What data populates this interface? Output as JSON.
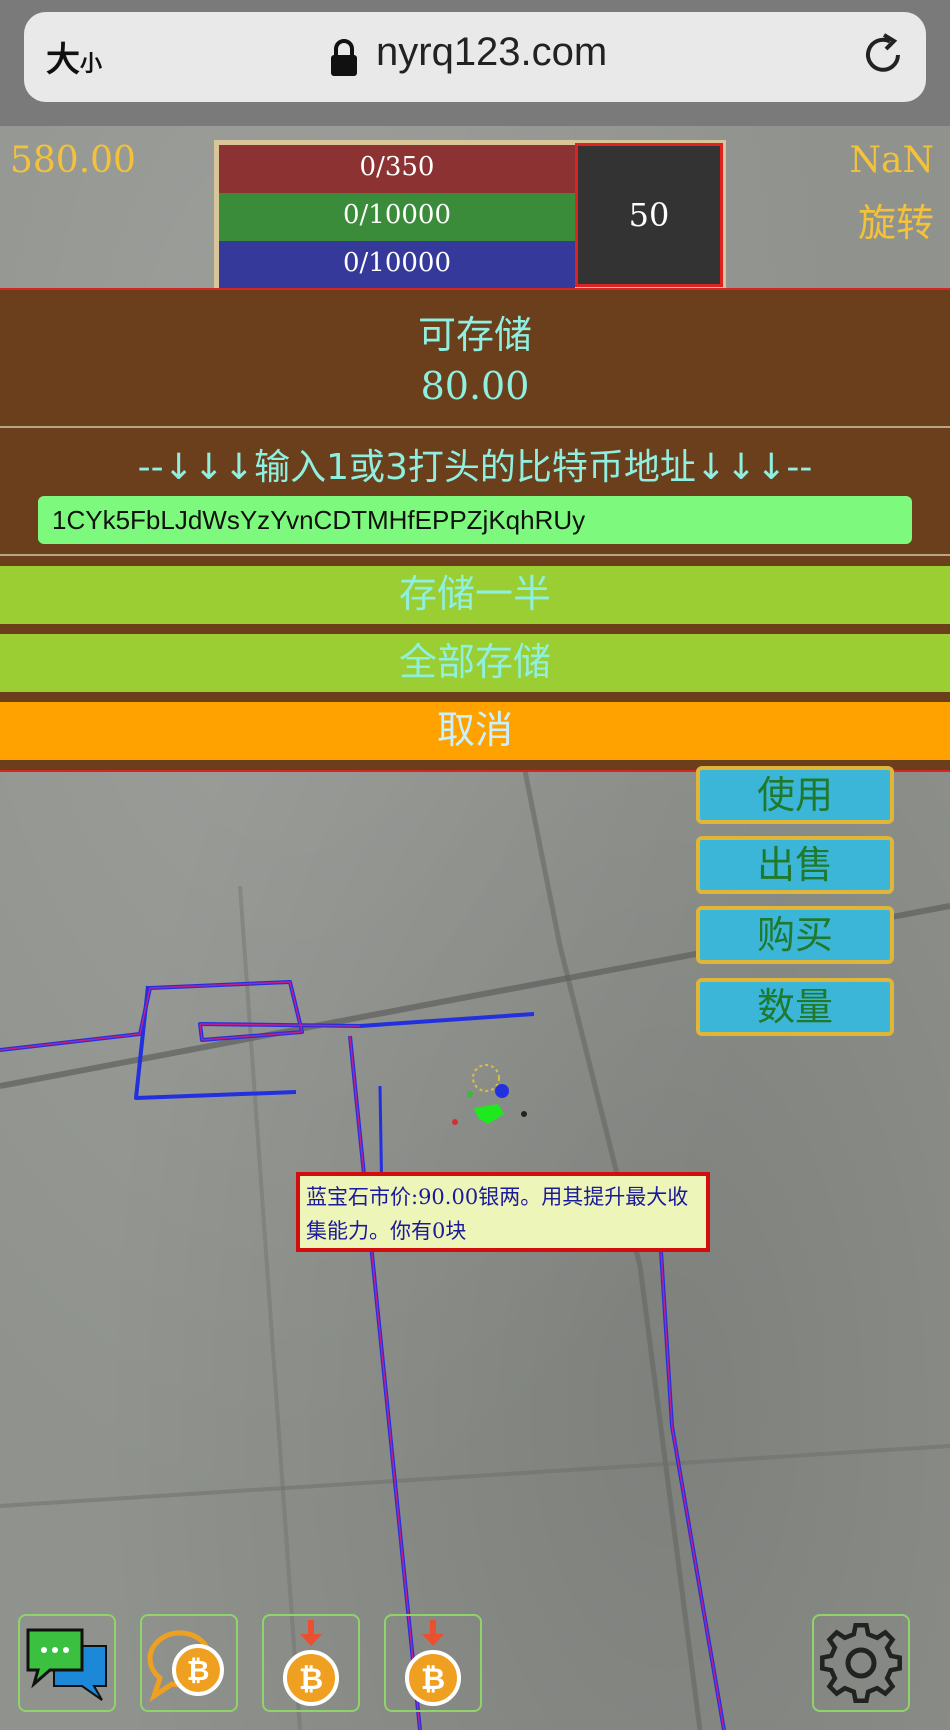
{
  "browser": {
    "text_size_large": "大",
    "text_size_small": "小",
    "url": "nyrq123.com"
  },
  "hud": {
    "silver": "580.00",
    "nan": "NaN",
    "rotate": "旋转",
    "stats": {
      "red": "0/350",
      "green": "0/10000",
      "blue": "0/10000",
      "box": "50"
    }
  },
  "dialog": {
    "title": "可存储",
    "amount": "80.00",
    "prompt": "--↓↓↓输入1或3打头的比特币地址↓↓↓--",
    "address_value": "1CYk5FbLJdWsYzYvnCDTMHfEPPZjKqhRUy",
    "btn_half": "存储一半",
    "btn_all": "全部存储",
    "btn_cancel": "取消"
  },
  "side_buttons": {
    "use": "使用",
    "sell": "出售",
    "buy": "购买",
    "qty": "数量"
  },
  "tooltip": {
    "text": "蓝宝石市价:90.00银两。用其提升最大收集能力。你有0块"
  },
  "toolbar": {
    "icons": [
      "chat-icon",
      "bitcoin-chat-icon",
      "bitcoin-download-icon",
      "bitcoin-download-icon",
      "gear-icon"
    ]
  },
  "colors": {
    "gold": "#f3c23a",
    "dialog_bg": "#6b3e1c",
    "dialog_text": "#8ff0e0",
    "green_btn": "#9ace32",
    "orange_btn": "#ffa200",
    "side_btn": "#3bb6d8",
    "address_field": "#7dfa7d",
    "route_line": "#2330e0"
  }
}
